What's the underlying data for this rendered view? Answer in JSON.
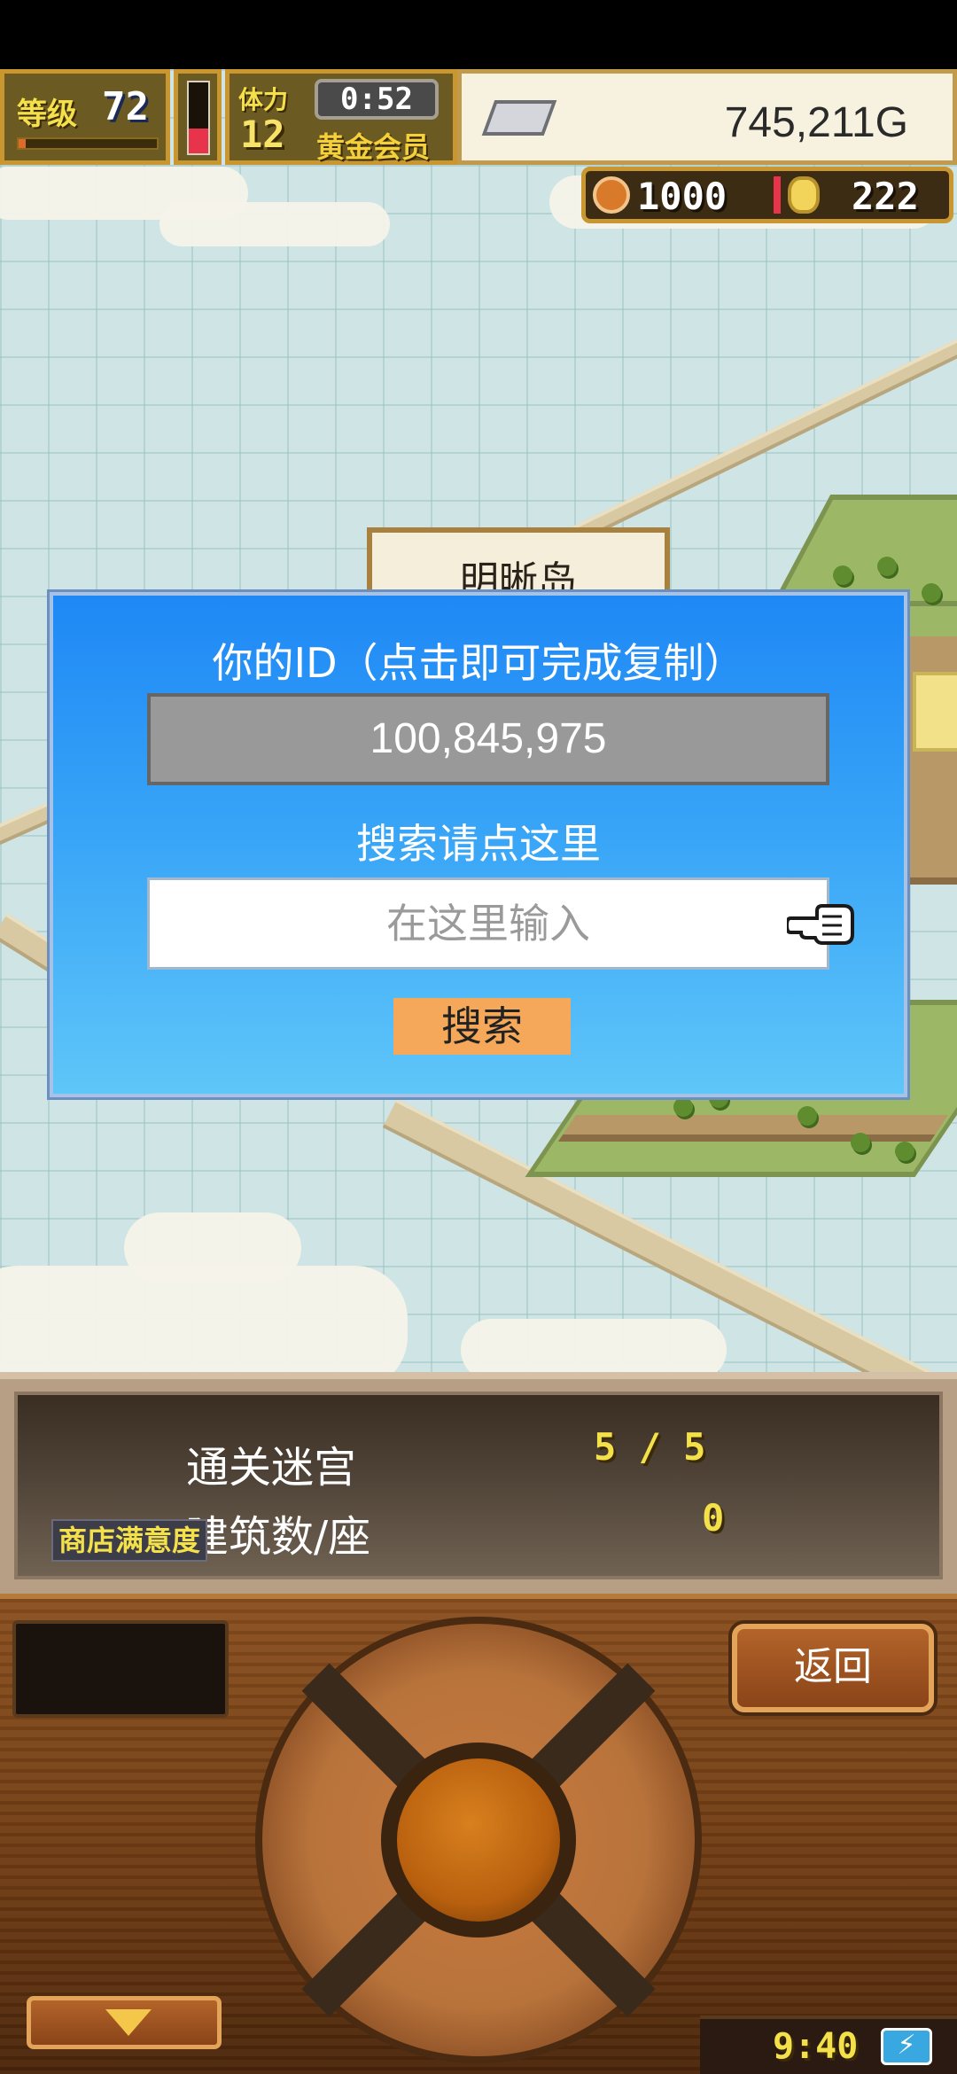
{
  "hud": {
    "level_label": "等级",
    "level_value": "72",
    "level_progress": 0.05,
    "stamina_level": 0.35,
    "strength_label": "体力",
    "strength_value": "12",
    "timer": "0:52",
    "membership": "黄金会员",
    "gold": "745,211G",
    "currency_a": "1000",
    "currency_b": "222"
  },
  "map": {
    "island_name": "明晰岛"
  },
  "dialog": {
    "title": "你的ID（点击即可完成复制）",
    "id_value": "100,845,975",
    "search_label": "搜索请点这里",
    "search_placeholder": "在这里输入",
    "search_button": "搜索"
  },
  "stats": {
    "rows": [
      {
        "label": "通关迷宫",
        "value": "5 /  5"
      },
      {
        "label": "建筑数/座",
        "value": "0"
      }
    ],
    "shop_badge": "商店满意度"
  },
  "controls": {
    "return_label": "返回",
    "clock": "9:40",
    "battery_icon": "⚡"
  },
  "colors": {
    "dialog_top": "#1e88f5",
    "dialog_bottom": "#5fc6f8",
    "accent_gold": "#f4e14a",
    "button_orange": "#f5a85a"
  }
}
